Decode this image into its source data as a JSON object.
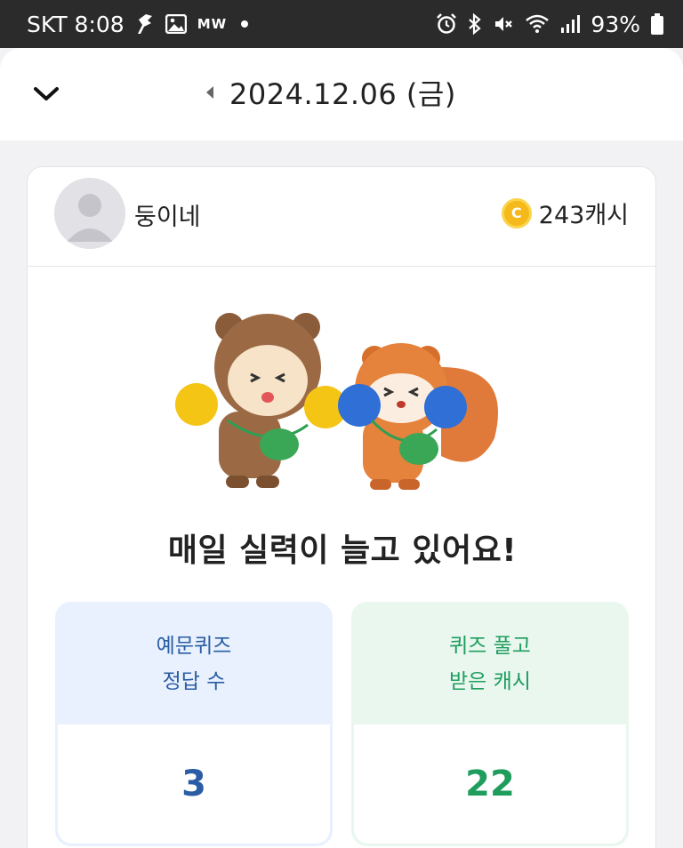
{
  "status_bar": {
    "carrier_time": "SKT 8:08",
    "badge": "MW",
    "battery": "93%"
  },
  "header": {
    "date": "2024.12.06 (금)"
  },
  "profile": {
    "name": "둥이네",
    "cash": "243캐시",
    "coin_symbol": "C"
  },
  "headline": "매일 실력이 늘고 있어요!",
  "stats": [
    {
      "label_line1": "예문퀴즈",
      "label_line2": "정답 수",
      "value": "3",
      "accent": "#2a5da3"
    },
    {
      "label_line1": "퀴즈 풀고",
      "label_line2": "받은 캐시",
      "value": "22",
      "accent": "#1f9d5d"
    }
  ],
  "icons": {
    "back": "chevron-down-icon",
    "prev": "caret-left-icon",
    "avatar": "default-avatar-icon",
    "coin": "coin-icon"
  }
}
